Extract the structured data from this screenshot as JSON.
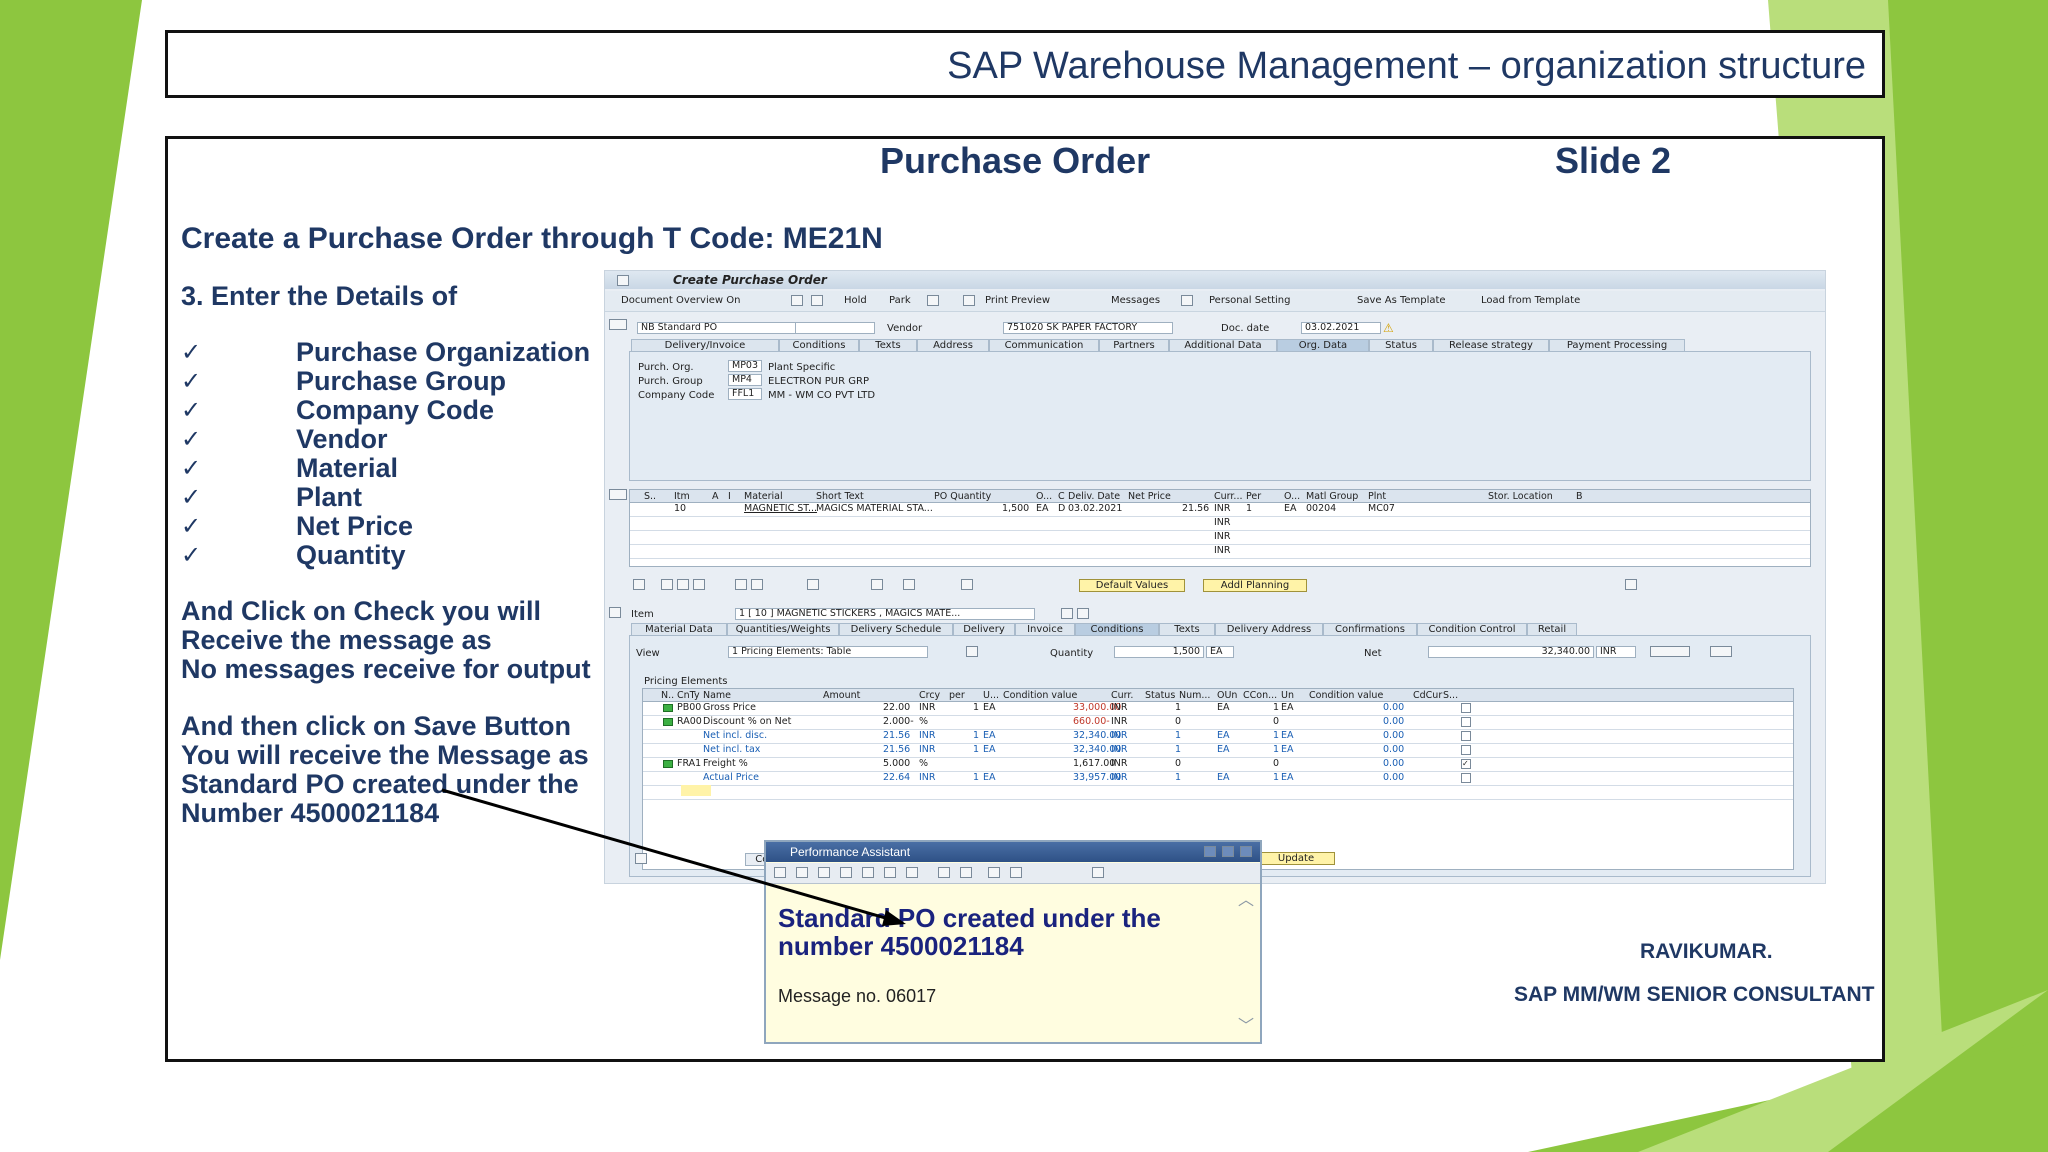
{
  "slide": {
    "title": "SAP Warehouse Management – organization structure",
    "heading": "Purchase Order",
    "slide_no": "Slide 2",
    "tcode_line": "Create a Purchase Order through T Code: ME21N",
    "step": "3. Enter the Details of",
    "checklist": [
      "Purchase Organization",
      "Purchase Group",
      "Company Code",
      "Vendor",
      "Material",
      "Plant",
      "Net Price",
      "Quantity"
    ],
    "check_line1": "And Click on Check you will",
    "check_line2": "Receive the message as",
    "check_line3": "No messages receive for output",
    "save_line1": "And then click on Save Button",
    "save_line2": "You will receive the Message as",
    "save_line3": "Standard PO created under the",
    "save_line4": "Number 4500021184",
    "author": "RAVIKUMAR.",
    "role": "SAP MM/WM SENIOR CONSULTANT",
    "accent_color": "#8dc63f",
    "text_color": "#1f3864"
  },
  "sap": {
    "window_title": "Create Purchase Order",
    "toolbar": [
      "Document Overview On",
      "Hold",
      "Park",
      "Print Preview",
      "Messages",
      "Personal Setting",
      "Save As Template",
      "Load from Template"
    ],
    "doc_type": "NB Standard PO",
    "vendor_label": "Vendor",
    "vendor": "751020 SK PAPER FACTORY",
    "doc_date_label": "Doc. date",
    "doc_date": "03.02.2021",
    "header_tabs": [
      "Delivery/Invoice",
      "Conditions",
      "Texts",
      "Address",
      "Communication",
      "Partners",
      "Additional Data",
      "Org. Data",
      "Status",
      "Release strategy",
      "Payment Processing"
    ],
    "org": {
      "porg_label": "Purch. Org.",
      "porg": "MP03",
      "porg_desc": "Plant Specific",
      "pgrp_label": "Purch. Group",
      "pgrp": "MP4",
      "pgrp_desc": "ELECTRON PUR GRP",
      "cc_label": "Company Code",
      "cc": "FFL1",
      "cc_desc": "MM - WM  CO PVT LTD"
    },
    "item_cols": [
      "S..",
      "Itm",
      "A",
      "I",
      "Material",
      "Short Text",
      "PO Quantity",
      "O...",
      "C",
      "Deliv. Date",
      "Net Price",
      "Curr...",
      "Per",
      "O...",
      "Matl Group",
      "Plnt",
      "Stor. Location",
      "B"
    ],
    "item_row": {
      "itm": "10",
      "material": "MAGNETIC ST...",
      "short_text": "MAGICS MATERIAL STA...",
      "qty": "1,500",
      "oun": "EA",
      "c": "D",
      "date": "03.02.2021",
      "price": "21.56",
      "curr": "INR",
      "per": "1",
      "opu": "EA",
      "matl_group": "00204",
      "plant": "MC07"
    },
    "curr_blank": "INR",
    "default_values": "Default Values",
    "addl_planning": "Addl Planning",
    "item_label": "Item",
    "item_select": "1 [ 10 ] MAGNETIC STICKERS , MAGICS MATE...",
    "item_tabs": [
      "Material Data",
      "Quantities/Weights",
      "Delivery Schedule",
      "Delivery",
      "Invoice",
      "Conditions",
      "Texts",
      "Delivery Address",
      "Confirmations",
      "Condition Control",
      "Retail"
    ],
    "view_label": "View",
    "view_value": "1 Pricing Elements: Table",
    "quantity_label": "Quantity",
    "quantity_value": "1,500",
    "quantity_unit": "EA",
    "net_label": "Net",
    "net_value": "32,340.00",
    "net_curr": "INR",
    "pricing_title": "Pricing Elements",
    "cond_cols": [
      "N..",
      "CnTy",
      "Name",
      "Amount",
      "Crcy",
      "per",
      "U...",
      "Condition value",
      "Curr.",
      "Status",
      "Num...",
      "OUn",
      "CCon...",
      "Un",
      "Condition value",
      "CdCur",
      "S..."
    ],
    "conditions": [
      {
        "cnty": "PB00",
        "name": "Gross Price",
        "amount": "22.00",
        "crcy": "INR",
        "per": "1",
        "u": "EA",
        "value": "33,000.00",
        "curr": "INR",
        "num": "1",
        "oun": "EA",
        "ccon": "1",
        "un": "EA",
        "value2": "0.00",
        "green": true,
        "blue": false
      },
      {
        "cnty": "RA00",
        "name": "Discount % on Net",
        "amount": "2.000-",
        "crcy": "%",
        "per": "",
        "u": "",
        "value": "660.00-",
        "curr": "INR",
        "num": "0",
        "oun": "",
        "ccon": "0",
        "un": "",
        "value2": "0.00",
        "green": true,
        "blue": false
      },
      {
        "cnty": "",
        "name": "Net incl. disc.",
        "amount": "21.56",
        "crcy": "INR",
        "per": "1",
        "u": "EA",
        "value": "32,340.00",
        "curr": "INR",
        "num": "1",
        "oun": "EA",
        "ccon": "1",
        "un": "EA",
        "value2": "0.00",
        "green": false,
        "blue": true
      },
      {
        "cnty": "",
        "name": "Net incl. tax",
        "amount": "21.56",
        "crcy": "INR",
        "per": "1",
        "u": "EA",
        "value": "32,340.00",
        "curr": "INR",
        "num": "1",
        "oun": "EA",
        "ccon": "1",
        "un": "EA",
        "value2": "0.00",
        "green": false,
        "blue": true
      },
      {
        "cnty": "FRA1",
        "name": "Freight %",
        "amount": "5.000",
        "crcy": "%",
        "per": "",
        "u": "",
        "value": "1,617.00",
        "curr": "INR",
        "num": "0",
        "oun": "",
        "ccon": "0",
        "un": "",
        "value2": "0.00",
        "green": true,
        "blue": false
      },
      {
        "cnty": "",
        "name": "Actual Price",
        "amount": "22.64",
        "crcy": "INR",
        "per": "1",
        "u": "EA",
        "value": "33,957.00",
        "curr": "INR",
        "num": "1",
        "oun": "EA",
        "ccon": "1",
        "un": "EA",
        "value2": "0.00",
        "green": false,
        "blue": true
      }
    ],
    "update_btn": "Update",
    "con_btn": "Con"
  },
  "popup": {
    "title": "Performance Assistant",
    "message_line1": "Standard PO created under the",
    "message_line2": "number 4500021184",
    "message_no": "Message no. 06017"
  }
}
